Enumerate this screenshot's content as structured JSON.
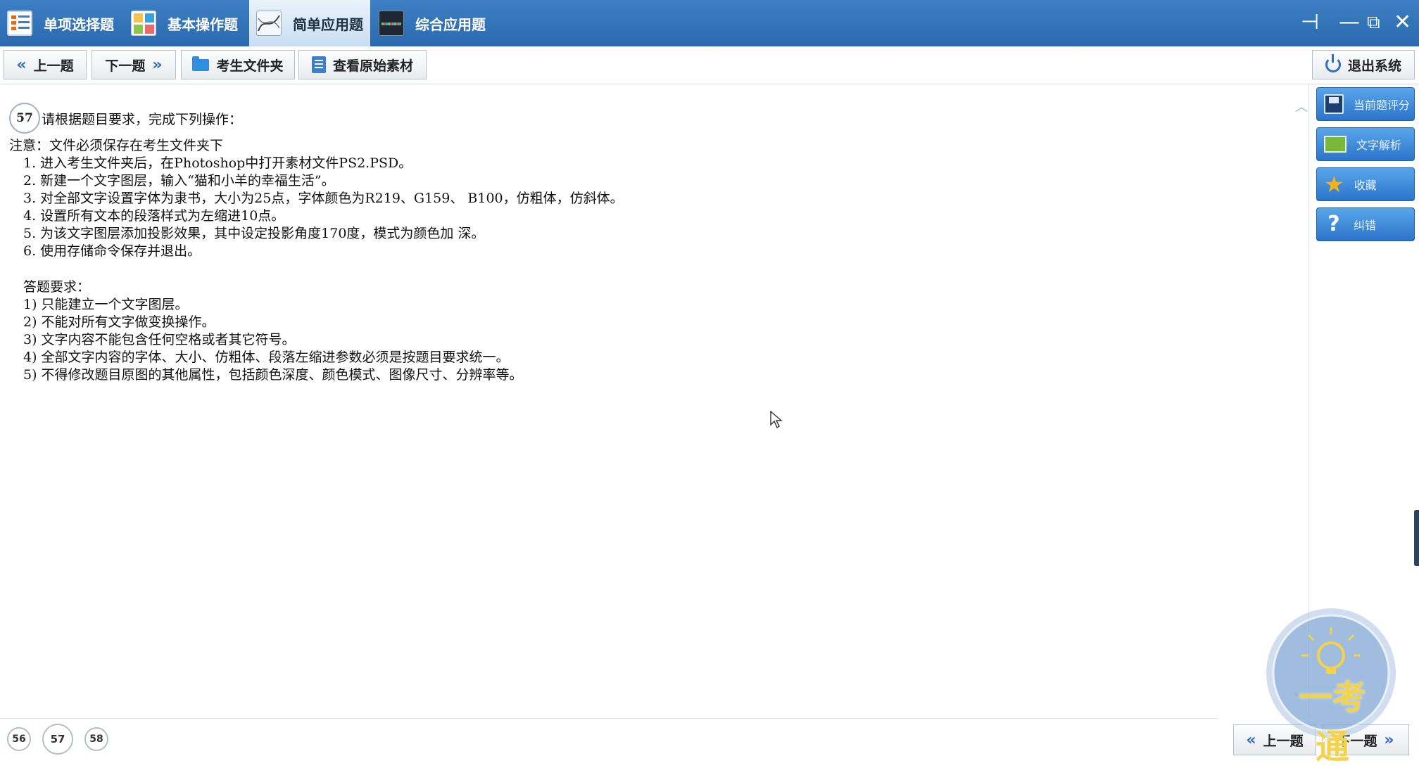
{
  "tabs": [
    {
      "label": "单项选择题",
      "icon": "list-icon",
      "active": false
    },
    {
      "label": "基本操作题",
      "icon": "grid-icon",
      "active": false
    },
    {
      "label": "简单应用题",
      "icon": "curve-icon",
      "active": true
    },
    {
      "label": "综合应用题",
      "icon": "chart-icon",
      "active": false
    }
  ],
  "window_controls": {
    "pin": "⊣",
    "minimize": "—",
    "restore": "⧉",
    "close": "✕"
  },
  "toolbar": {
    "prev_label": "上一题",
    "next_label": "下一题",
    "folder_label": "考生文件夹",
    "source_label": "查看原始素材",
    "exit_label": "退出系统"
  },
  "question": {
    "number": "57",
    "title": "请根据题目要求，完成下列操作：",
    "lines": [
      "注意：文件必须保存在考生文件夹下",
      "1. 进入考生文件夹后，在Photoshop中打开素材文件PS2.PSD。",
      "2. 新建一个文字图层，输入“猫和小羊的幸福生活”。",
      "3. 对全部文字设置字体为隶书，大小为25点，字体颜色为R219、G159、 B100，仿粗体，仿斜体。",
      "4. 设置所有文本的段落样式为左缩进10点。",
      "5. 为该文字图层添加投影效果，其中设定投影角度170度，模式为颜色加 深。",
      "6. 使用存储命令保存并退出。",
      "答题要求：",
      "1) 只能建立一个文字图层。",
      "2) 不能对所有文字做变换操作。",
      "3) 文字内容不能包含任何空格或者其它符号。",
      "4) 全部文字内容的字体、大小、仿粗体、段落左缩进参数必须是按题目要求统一。",
      "5) 不得修改题目原图的其他属性，包括颜色深度、颜色模式、图像尺寸、分辨率等。"
    ]
  },
  "side_buttons": [
    {
      "label": "当前题评分",
      "icon": "save-icon"
    },
    {
      "label": "文字解析",
      "icon": "book-icon"
    },
    {
      "label": "收藏",
      "icon": "star-icon"
    },
    {
      "label": "纠错",
      "icon": "help-icon"
    }
  ],
  "pagination": [
    "56",
    "57",
    "58"
  ],
  "footer": {
    "prev_label": "上一题",
    "next_label": "下一题"
  },
  "watermark": {
    "text": "一考通"
  },
  "colors": {
    "header_blue": "#2f72b8",
    "accent_blue": "#2f6fbe",
    "active_tab": "#dbe8f6"
  }
}
